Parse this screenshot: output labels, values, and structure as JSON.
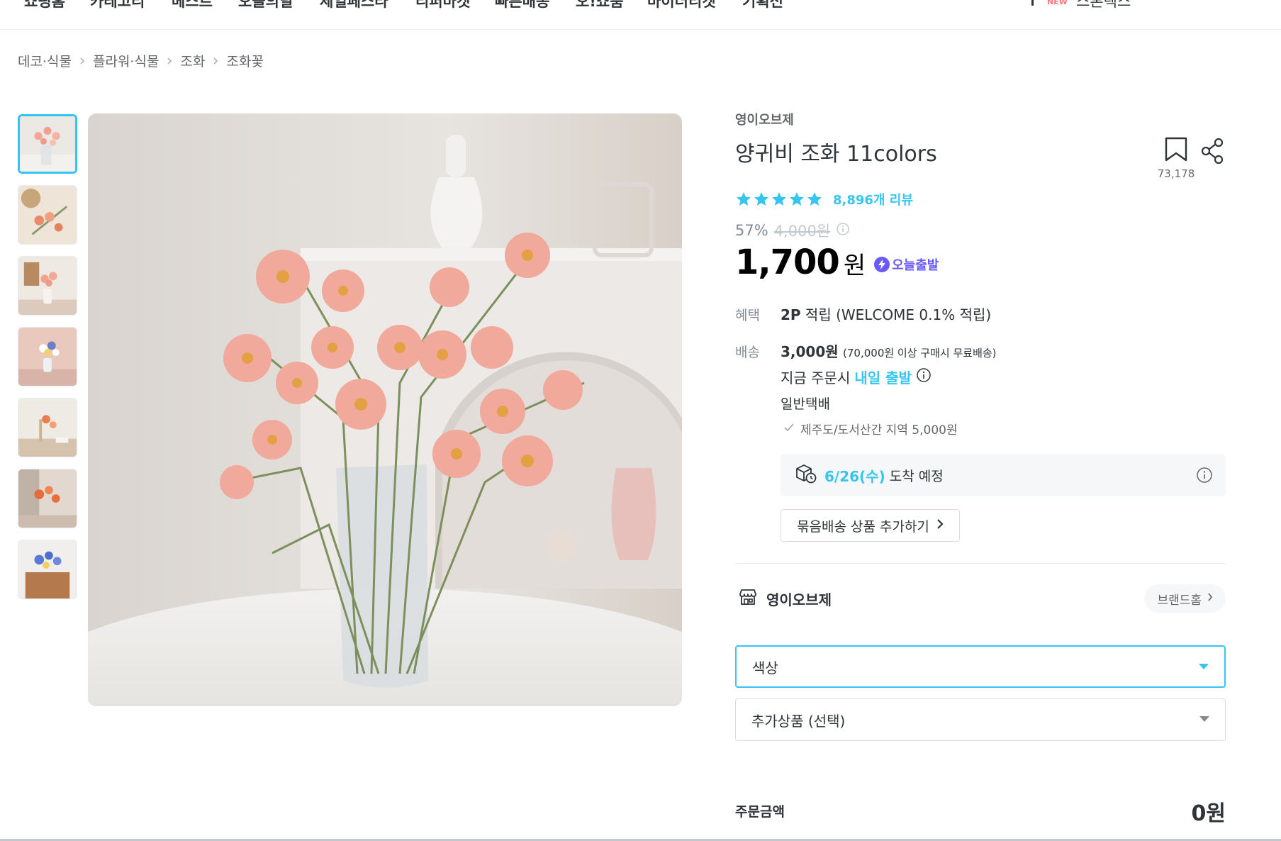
{
  "nav": {
    "items": [
      "쇼핑홈",
      "카테고리",
      "베스트",
      "오늘의딜",
      "세일페스타",
      "리퍼마켓",
      "빠른배송",
      "오!쇼룸",
      "바이더티켓",
      "기획전"
    ],
    "new_badge": "NEW",
    "ranking_text": "스톤텍스"
  },
  "breadcrumb": [
    "데코·식물",
    "플라워·식물",
    "조화",
    "조화꽃"
  ],
  "product": {
    "brand": "영이오브제",
    "title": "양귀비 조화 11colors",
    "bookmark_count": "73,178",
    "rating": 5,
    "review_text": "8,896개 리뷰",
    "discount": "57%",
    "original_price": "4,000원",
    "price": "1,700",
    "currency": "원",
    "today_badge": "오늘출발"
  },
  "benefit": {
    "label": "혜택",
    "points": "2P",
    "text": " 적립 (WELCOME 0.1% 적립)"
  },
  "shipping": {
    "label": "배송",
    "fee": "3,000원",
    "fee_note": "(70,000원 이상 구매시 무료배송)",
    "order_text": "지금 주문시",
    "order_highlight": "내일 출발",
    "type": "일반택배",
    "note": "제주도/도서산간 지역 5,000원",
    "arrival_date": "6/26(수)",
    "arrival_text": "도착 예정"
  },
  "bundle_button": "묶음배송 상품 추가하기",
  "shop": {
    "name": "영이오브제",
    "brand_home": "브랜드홈"
  },
  "options": {
    "color": "색상",
    "extra": "추가상품 (선택)"
  },
  "order": {
    "label": "주문금액",
    "total": "0원"
  },
  "colors": {
    "accent": "#35c5f0",
    "today": "#6a5af9",
    "text": "#2f3438"
  }
}
